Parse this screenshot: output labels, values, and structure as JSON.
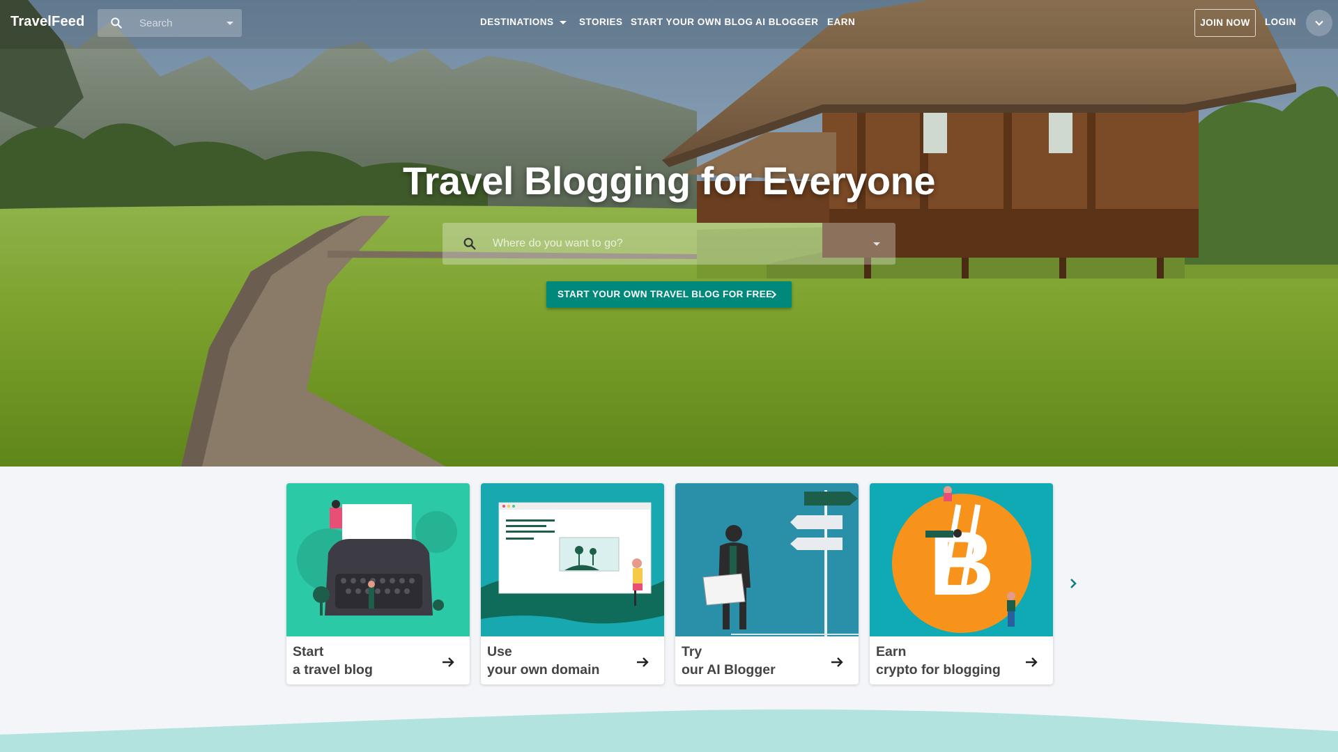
{
  "nav": {
    "brand": "TravelFeed",
    "search_placeholder": "Search",
    "menu": {
      "destinations": "DESTINATIONS",
      "stories": "STORIES",
      "start_blog": "START YOUR OWN BLOG",
      "ai_blogger": "AI BLOGGER",
      "earn": "EARN"
    },
    "join": "JOIN NOW",
    "login": "LOGIN"
  },
  "hero": {
    "title": "Travel Blogging for Everyone",
    "search_placeholder": "Where do you want to go?",
    "cta": "START YOUR OWN TRAVEL BLOG FOR FREE"
  },
  "cards": [
    {
      "line1": "Start",
      "line2": "a travel blog"
    },
    {
      "line1": "Use",
      "line2": "your own domain"
    },
    {
      "line1": "Try",
      "line2": "our AI Blogger"
    },
    {
      "line1": "Earn",
      "line2": "crypto for blogging"
    }
  ],
  "colors": {
    "accent": "#00897b",
    "card1_bg": "#2cc9a6",
    "card2_bg": "#17a8b0",
    "card3_bg": "#2a8fa8",
    "card4_bg": "#10aab4",
    "bitcoin": "#f7931a",
    "wave": "#b2e3df"
  },
  "icons": {
    "nav_search": "search-icon",
    "account": "chevron-down-icon",
    "cta": "chevron-right-icon",
    "card_arrow": "arrow-right-icon",
    "carousel": "chevron-right-icon"
  }
}
